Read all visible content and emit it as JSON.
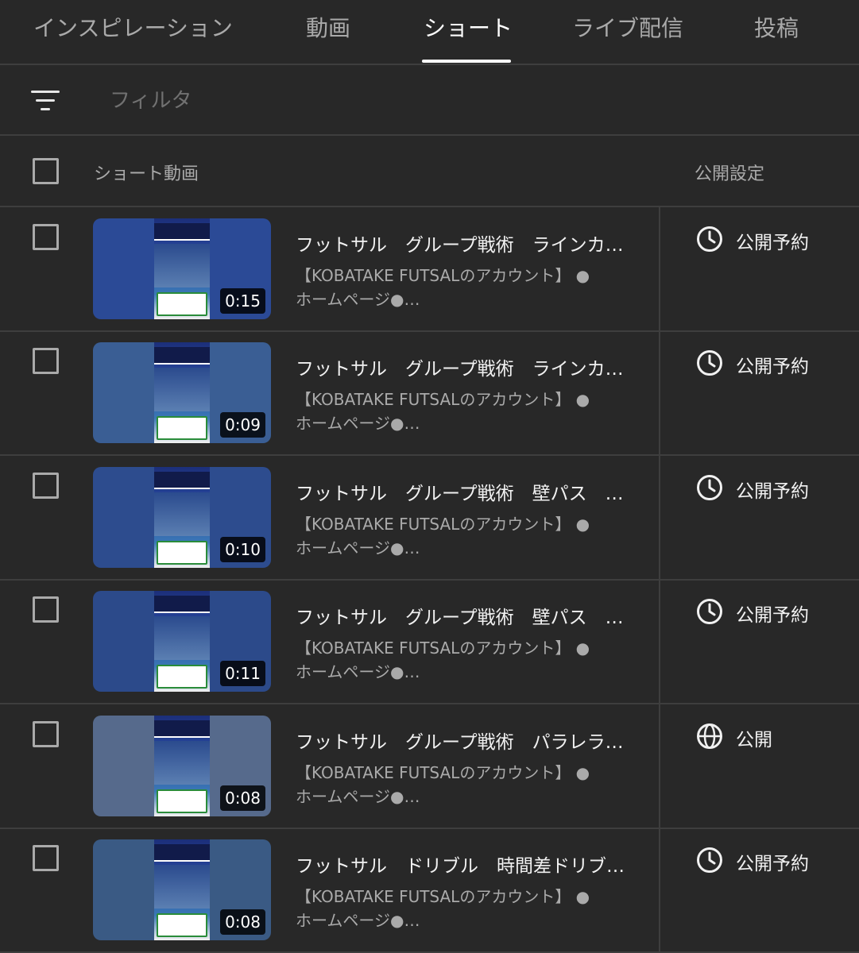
{
  "tabs": [
    {
      "label": "インスピレーション",
      "active": false
    },
    {
      "label": "動画",
      "active": false
    },
    {
      "label": "ショート",
      "active": true
    },
    {
      "label": "ライブ配信",
      "active": false
    },
    {
      "label": "投稿",
      "active": false
    }
  ],
  "filter": {
    "placeholder": "フィルタ",
    "icon": "filter-icon"
  },
  "header": {
    "title": "ショート動画",
    "visibility": "公開設定"
  },
  "rows": [
    {
      "title": "フットサル　グループ戦術　ラインカ…",
      "desc1": "【KOBATAKE FUTSALのアカウント】 ●",
      "desc2": "ホームページ●…",
      "duration": "0:15",
      "visibility": "公開予約",
      "visibility_icon": "clock-icon",
      "thumb_bg": "#2b4a96"
    },
    {
      "title": "フットサル　グループ戦術　ラインカ…",
      "desc1": "【KOBATAKE FUTSALのアカウント】 ●",
      "desc2": "ホームページ●…",
      "duration": "0:09",
      "visibility": "公開予約",
      "visibility_icon": "clock-icon",
      "thumb_bg": "#3a5e94"
    },
    {
      "title": "フットサル　グループ戦術　壁パス　…",
      "desc1": "【KOBATAKE FUTSALのアカウント】 ●",
      "desc2": "ホームページ●…",
      "duration": "0:10",
      "visibility": "公開予約",
      "visibility_icon": "clock-icon",
      "thumb_bg": "#2d4c8e"
    },
    {
      "title": "フットサル　グループ戦術　壁パス　…",
      "desc1": "【KOBATAKE FUTSALのアカウント】 ●",
      "desc2": "ホームページ●…",
      "duration": "0:11",
      "visibility": "公開予約",
      "visibility_icon": "clock-icon",
      "thumb_bg": "#2c4a8a"
    },
    {
      "title": "フットサル　グループ戦術　パラレラ…",
      "desc1": "【KOBATAKE FUTSALのアカウント】 ●",
      "desc2": "ホームページ●…",
      "duration": "0:08",
      "visibility": "公開",
      "visibility_icon": "globe-icon",
      "thumb_bg": "#566a8c"
    },
    {
      "title": "フットサル　ドリブル　時間差ドリブ…",
      "desc1": "【KOBATAKE FUTSALのアカウント】 ●",
      "desc2": "ホームページ●…",
      "duration": "0:08",
      "visibility": "公開予約",
      "visibility_icon": "clock-icon",
      "thumb_bg": "#3a5a84"
    }
  ]
}
